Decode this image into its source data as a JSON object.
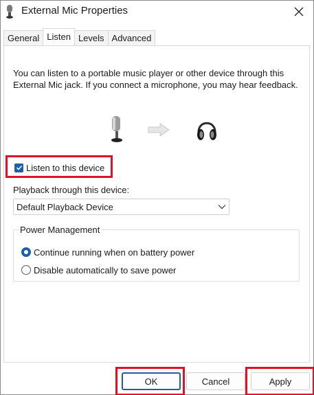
{
  "window": {
    "title": "External Mic Properties"
  },
  "tabs": [
    {
      "label": "General"
    },
    {
      "label": "Listen"
    },
    {
      "label": "Levels"
    },
    {
      "label": "Advanced"
    }
  ],
  "active_tab": "Listen",
  "listen": {
    "description": "You can listen to a portable music player or other device through this External Mic jack.  If you connect a microphone, you may hear feedback.",
    "listen_checkbox_label": "Listen to this device",
    "listen_checked": true,
    "playback_label": "Playback through this device:",
    "playback_device": "Default Playback Device"
  },
  "power": {
    "group_title": "Power Management",
    "options": [
      {
        "label": "Continue running when on battery power",
        "selected": true
      },
      {
        "label": "Disable automatically to save power",
        "selected": false
      }
    ]
  },
  "buttons": {
    "ok": "OK",
    "cancel": "Cancel",
    "apply": "Apply"
  },
  "colors": {
    "accent": "#1f5fa8",
    "highlight": "#e0102a"
  },
  "icons": {
    "title": "microphone-icon",
    "close": "close-icon",
    "device_source": "microphone-icon",
    "flow": "arrow-right-icon",
    "device_target": "headphones-icon",
    "dropdown": "chevron-down-icon",
    "checkbox": "checkmark-icon"
  }
}
